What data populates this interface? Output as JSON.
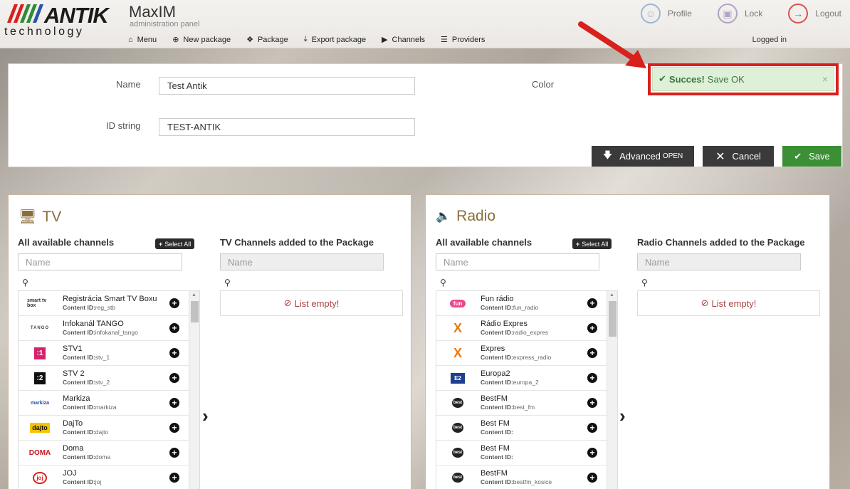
{
  "brand": {
    "logo_text": "ANTIK",
    "logo_sub": "technology",
    "app_title": "MaxIM",
    "app_sub": "administration panel"
  },
  "nav": [
    {
      "label": "Menu",
      "icon": "home-icon"
    },
    {
      "label": "New package",
      "icon": "plus-circle-icon"
    },
    {
      "label": "Package",
      "icon": "cubes-icon"
    },
    {
      "label": "Export package",
      "icon": "download-icon"
    },
    {
      "label": "Channels",
      "icon": "play-icon"
    },
    {
      "label": "Providers",
      "icon": "list-icon"
    }
  ],
  "top_actions": [
    {
      "label": "Profile",
      "icon": "user-icon"
    },
    {
      "label": "Lock",
      "icon": "lock-icon"
    },
    {
      "label": "Logout",
      "icon": "logout-icon"
    }
  ],
  "logged_in": "Logged in",
  "form": {
    "name_label": "Name",
    "name_value": "Test Antik",
    "id_label": "ID string",
    "id_value": "TEST-ANTIK",
    "color_label": "Color",
    "advanced_label": "Advanced",
    "advanced_tag": "OPEN",
    "cancel_label": "Cancel",
    "save_label": "Save"
  },
  "toast": {
    "title": "Succes!",
    "message": "Save OK",
    "close": "×"
  },
  "tv": {
    "title": "TV",
    "available_head": "All available channels",
    "select_all": "Select All",
    "added_head": "TV Channels added to the Package",
    "search_placeholder": "Name",
    "empty": "List empty!",
    "content_id_label": "Content ID:",
    "channels": [
      {
        "name": "Registrácia Smart TV Boxu",
        "id": "reg_stb",
        "logo": "smart tv box"
      },
      {
        "name": "Infokanál TANGO",
        "id": "infokanal_tango",
        "logo": "TANGO"
      },
      {
        "name": "STV1",
        "id": "stv_1",
        "logo": ":1"
      },
      {
        "name": "STV 2",
        "id": "stv_2",
        "logo": ":2"
      },
      {
        "name": "Markiza",
        "id": "markiza",
        "logo": "markiza"
      },
      {
        "name": "DajTo",
        "id": "dajto",
        "logo": "dajto"
      },
      {
        "name": "Doma",
        "id": "doma",
        "logo": "DOMA"
      },
      {
        "name": "JOJ",
        "id": "joj",
        "logo": "joj"
      }
    ]
  },
  "radio": {
    "title": "Radio",
    "available_head": "All available channels",
    "select_all": "Select All",
    "added_head": "Radio Channels added to the Package",
    "search_placeholder": "Name",
    "empty": "List empty!",
    "content_id_label": "Content ID:",
    "channels": [
      {
        "name": "Fun rádio",
        "id": "fun_radio",
        "logo": "fun"
      },
      {
        "name": "Rádio Expres",
        "id": "radio_expres",
        "logo": "X"
      },
      {
        "name": "Expres",
        "id": "express_radio",
        "logo": "X"
      },
      {
        "name": "Europa2",
        "id": "europa_2",
        "logo": "E2"
      },
      {
        "name": "BestFM",
        "id": "best_fm",
        "logo": "best"
      },
      {
        "name": "Best FM",
        "id": "",
        "logo": "best"
      },
      {
        "name": "Best FM",
        "id": "",
        "logo": "best"
      },
      {
        "name": "BestFM",
        "id": "bestfm_kosice",
        "logo": "best"
      }
    ]
  },
  "colors": {
    "accent_brown": "#8a6d3b",
    "success_green": "#3c8f35",
    "toast_bg": "#dff0d8",
    "highlight_red": "#d8201c",
    "dark_button": "#3a3a3a"
  }
}
